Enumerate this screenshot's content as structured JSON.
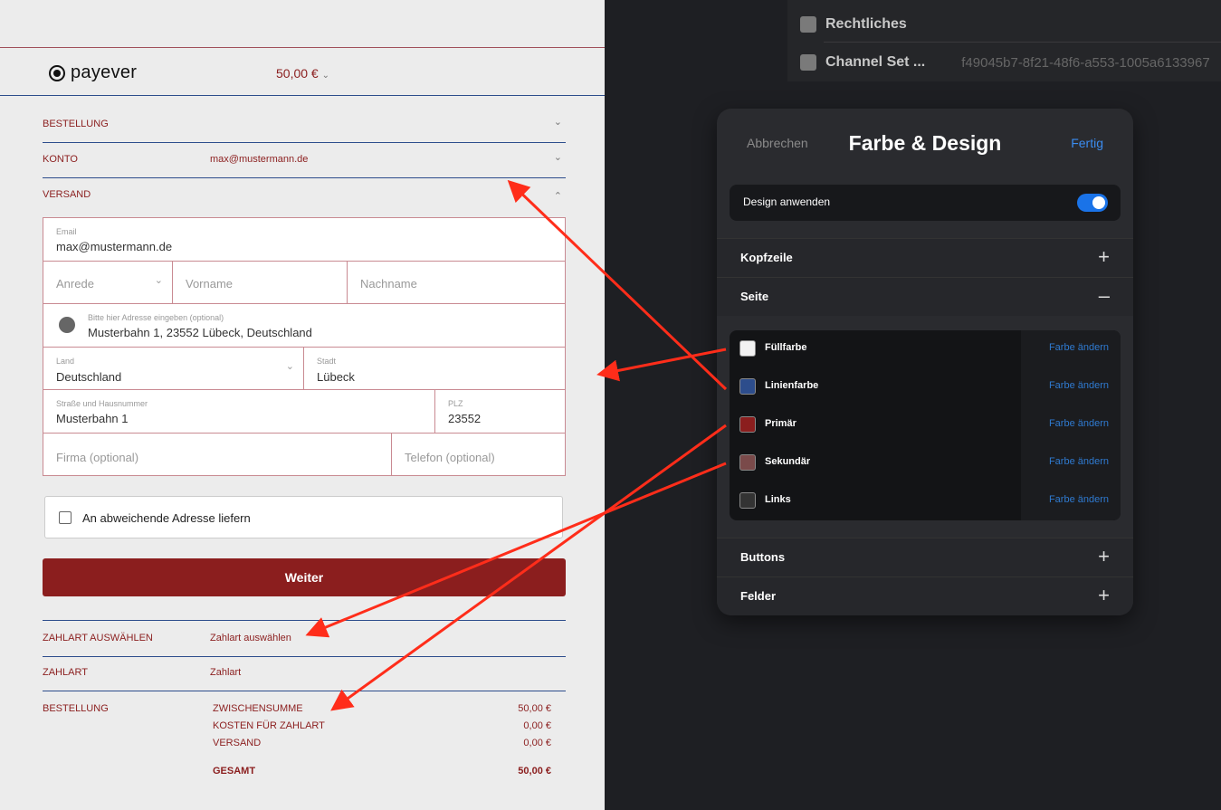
{
  "checkout": {
    "logo": "payever",
    "amount": "50,00 €",
    "sections": {
      "bestellung": "BESTELLUNG",
      "konto": "KONTO",
      "konto_value": "max@mustermann.de",
      "versand": "VERSAND"
    },
    "form": {
      "email_label": "Email",
      "email_value": "max@mustermann.de",
      "anrede": "Anrede",
      "vorname": "Vorname",
      "nachname": "Nachname",
      "address_label": "Bitte hier Adresse eingeben (optional)",
      "address_value": "Musterbahn 1, 23552 Lübeck, Deutschland",
      "land_label": "Land",
      "land_value": "Deutschland",
      "stadt_label": "Stadt",
      "stadt_value": "Lübeck",
      "street_label": "Straße und Hausnummer",
      "street_value": "Musterbahn 1",
      "plz_label": "PLZ",
      "plz_value": "23552",
      "firma": "Firma (optional)",
      "telefon": "Telefon (optional)"
    },
    "checkbox_label": "An abweichende Adresse liefern",
    "weiter": "Weiter",
    "zahlart_waehlen_label": "ZAHLART AUSWÄHLEN",
    "zahlart_waehlen_value": "Zahlart auswählen",
    "zahlart_label": "ZAHLART",
    "zahlart_value": "Zahlart",
    "summary_label": "BESTELLUNG",
    "summary": [
      {
        "label": "ZWISCHENSUMME",
        "value": "50,00 €"
      },
      {
        "label": "KOSTEN FÜR ZAHLART",
        "value": "0,00 €"
      },
      {
        "label": "VERSAND",
        "value": "0,00 €"
      },
      {
        "label": "GESAMT",
        "value": "50,00 €"
      }
    ]
  },
  "background_list": {
    "row1": "Rechtliches",
    "row2": "Channel Set ...",
    "row2_value": "f49045b7-8f21-48f6-a553-1005a6133967"
  },
  "panel": {
    "cancel": "Abbrechen",
    "title": "Farbe & Design",
    "done": "Fertig",
    "toggle_label": "Design anwenden",
    "kopfzeile": "Kopfzeile",
    "seite": "Seite",
    "buttons": "Buttons",
    "felder": "Felder",
    "change_label": "Farbe ändern",
    "colors": [
      {
        "name": "Füllfarbe",
        "color": "#f2f2f2"
      },
      {
        "name": "Linienfarbe",
        "color": "#2d4d8c"
      },
      {
        "name": "Primär",
        "color": "#8b1e1e"
      },
      {
        "name": "Sekundär",
        "color": "#7a4a4a"
      },
      {
        "name": "Links",
        "color": "#333333"
      }
    ]
  }
}
